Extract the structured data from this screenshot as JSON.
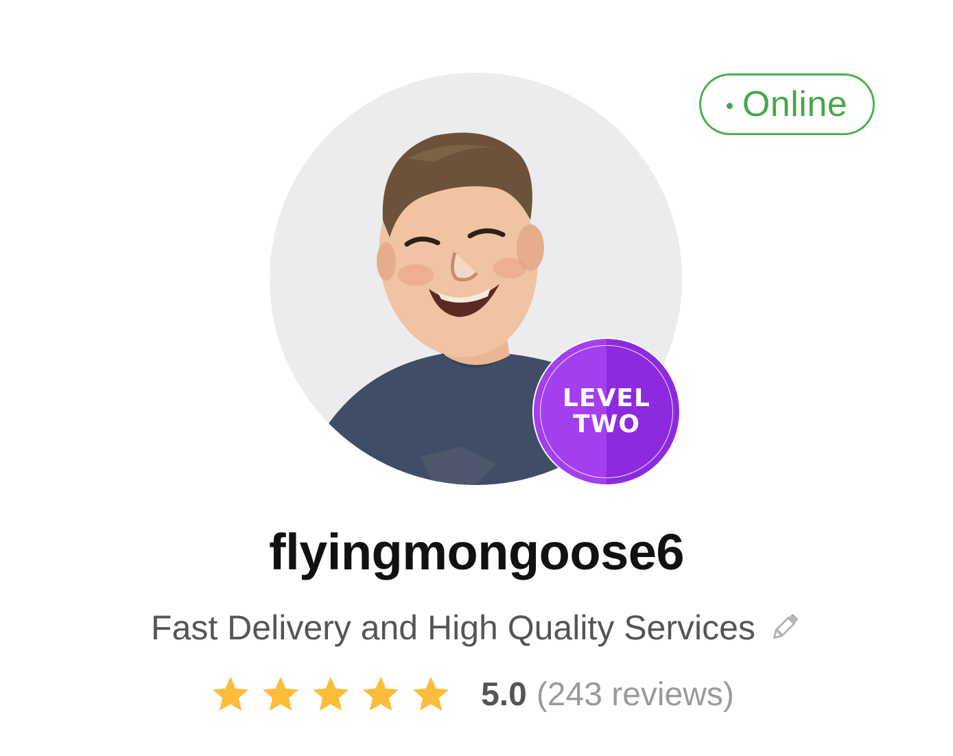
{
  "status": {
    "label": "Online",
    "color": "#45a849"
  },
  "seller": {
    "avatar_icon": "profile-photo",
    "level_line1": "LEVEL",
    "level_line2": "TWO",
    "level_color": "#a43ff0",
    "username": "flyingmongoose6",
    "tagline": "Fast Delivery and High Quality Services",
    "edit_icon": "pencil-icon"
  },
  "rating": {
    "stars": 5,
    "max_stars": 5,
    "star_color": "#fcbd3a",
    "score": "5.0",
    "reviews": "(243 reviews)"
  }
}
